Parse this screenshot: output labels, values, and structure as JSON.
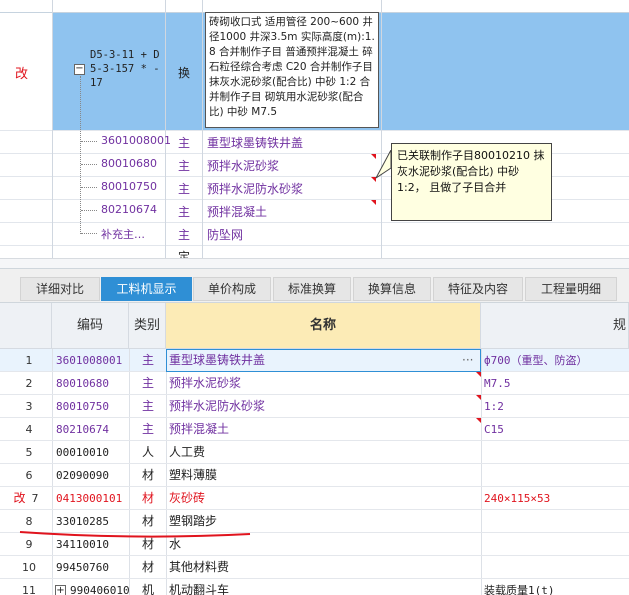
{
  "top": {
    "main_item": {
      "status_mark": "改",
      "code": "D5-3-11 + D5-3-157 * -17",
      "type": "换",
      "description": "砖砌收口式 适用管径 200~600 井径1000 井深3.5m 实际高度(m):1.8 合并制作子目 普通预拌混凝土 碎石粒径综合考虑 C20 合并制作子目 抹灰水泥砂浆(配合比) 中砂 1:2 合并制作子目 砌筑用水泥砂浆(配合比) 中砂 M7.5"
    },
    "sub_items": [
      {
        "code": "3601008001",
        "type": "主",
        "name": "重型球墨铸铁井盖"
      },
      {
        "code": "80010680",
        "type": "主",
        "name": "预拌水泥砂浆"
      },
      {
        "code": "80010750",
        "type": "主",
        "name": "预拌水泥防水砂浆"
      },
      {
        "code": "80210674",
        "type": "主",
        "name": "预拌混凝土"
      },
      {
        "code": "补充主…",
        "type": "主",
        "name": "防坠网"
      }
    ],
    "partial_row_type": "定",
    "comment": "已关联制作子目80010210 抹灰水泥砂浆(配合比) 中砂 1:2， 且做了子目合并"
  },
  "tabs": [
    "详细对比",
    "工料机显示",
    "单价构成",
    "标准换算",
    "换算信息",
    "特征及内容",
    "工程量明细"
  ],
  "active_tab": 1,
  "grid": {
    "headers": {
      "code": "编码",
      "type": "类别",
      "name": "名称",
      "spec": "规"
    },
    "rows": [
      {
        "idx": "1",
        "mark": "",
        "code": "3601008001",
        "type": "主",
        "name": "重型球墨铸铁井盖",
        "spec": "ф700（重型、防盗）",
        "color": "#7030a0",
        "more": "···"
      },
      {
        "idx": "2",
        "mark": "",
        "code": "80010680",
        "type": "主",
        "name": "预拌水泥砂浆",
        "spec": "M7.5",
        "color": "#7030a0"
      },
      {
        "idx": "3",
        "mark": "",
        "code": "80010750",
        "type": "主",
        "name": "预拌水泥防水砂浆",
        "spec": "1:2",
        "color": "#7030a0"
      },
      {
        "idx": "4",
        "mark": "",
        "code": "80210674",
        "type": "主",
        "name": "预拌混凝土",
        "spec": "C15",
        "color": "#7030a0"
      },
      {
        "idx": "5",
        "mark": "",
        "code": "00010010",
        "type": "人",
        "name": "人工费",
        "spec": "",
        "color": "#222222"
      },
      {
        "idx": "6",
        "mark": "",
        "code": "02090090",
        "type": "材",
        "name": "塑料薄膜",
        "spec": "",
        "color": "#222222"
      },
      {
        "idx": "7",
        "mark": "改",
        "code": "0413000101",
        "type": "材",
        "name": "灰砂砖",
        "spec": "240×115×53",
        "color": "#e0141e"
      },
      {
        "idx": "8",
        "mark": "",
        "code": "33010285",
        "type": "材",
        "name": "塑钢踏步",
        "spec": "",
        "color": "#222222"
      },
      {
        "idx": "9",
        "mark": "",
        "code": "34110010",
        "type": "材",
        "name": "水",
        "spec": "",
        "color": "#222222"
      },
      {
        "idx": "10",
        "mark": "",
        "code": "99450760",
        "type": "材",
        "name": "其他材料费",
        "spec": "",
        "color": "#222222"
      },
      {
        "idx": "11",
        "mark": "",
        "code": "990406010",
        "type": "机",
        "name": "机动翻斗车",
        "spec": "装载质量1(t)",
        "color": "#222222",
        "expand": "+"
      }
    ]
  }
}
